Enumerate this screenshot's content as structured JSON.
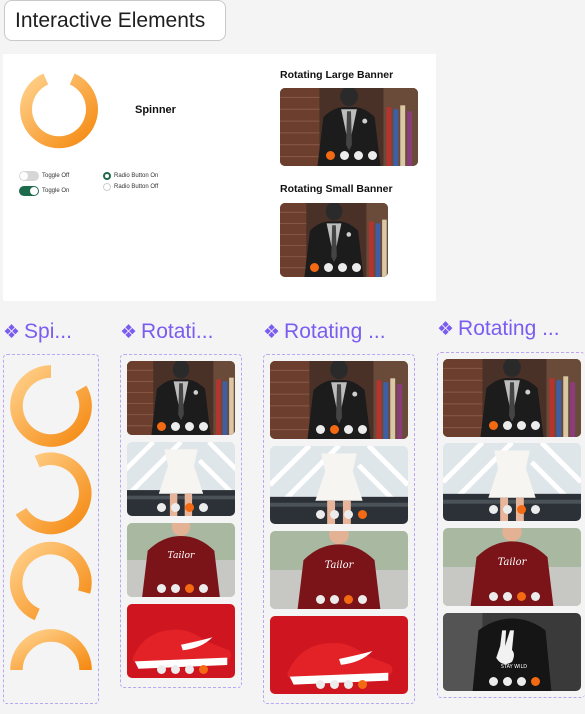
{
  "page": {
    "title": "Interactive Elements"
  },
  "demo": {
    "spinner_label": "Spinner",
    "toggle_off_label": "Toggle Off",
    "toggle_on_label": "Toggle On",
    "radio_on_label": "Radio Button On",
    "radio_off_label": "Radio Button Off",
    "large_banner_title": "Rotating Large Banner",
    "small_banner_title": "Rotating Small Banner"
  },
  "components": [
    {
      "icon": "diamond-component-icon",
      "label": "Spi..."
    },
    {
      "icon": "diamond-component-icon",
      "label": "Rotati..."
    },
    {
      "icon": "diamond-component-icon",
      "label": "Rotating ..."
    },
    {
      "icon": "diamond-component-icon",
      "label": "Rotating ..."
    }
  ],
  "colors": {
    "accent_orange": "#f46a12",
    "toggle_green": "#1d6b4a",
    "component_purple": "#7b5cf0"
  },
  "carousel_dot_states": {
    "large_banner": {
      "count": 4,
      "active": 1
    },
    "small_banner": {
      "count": 4,
      "active": 1
    },
    "variant_a": [
      1,
      3,
      3,
      4
    ],
    "variant_b": [
      2,
      4,
      3,
      4
    ],
    "variant_c": [
      1,
      3,
      3,
      3
    ]
  }
}
